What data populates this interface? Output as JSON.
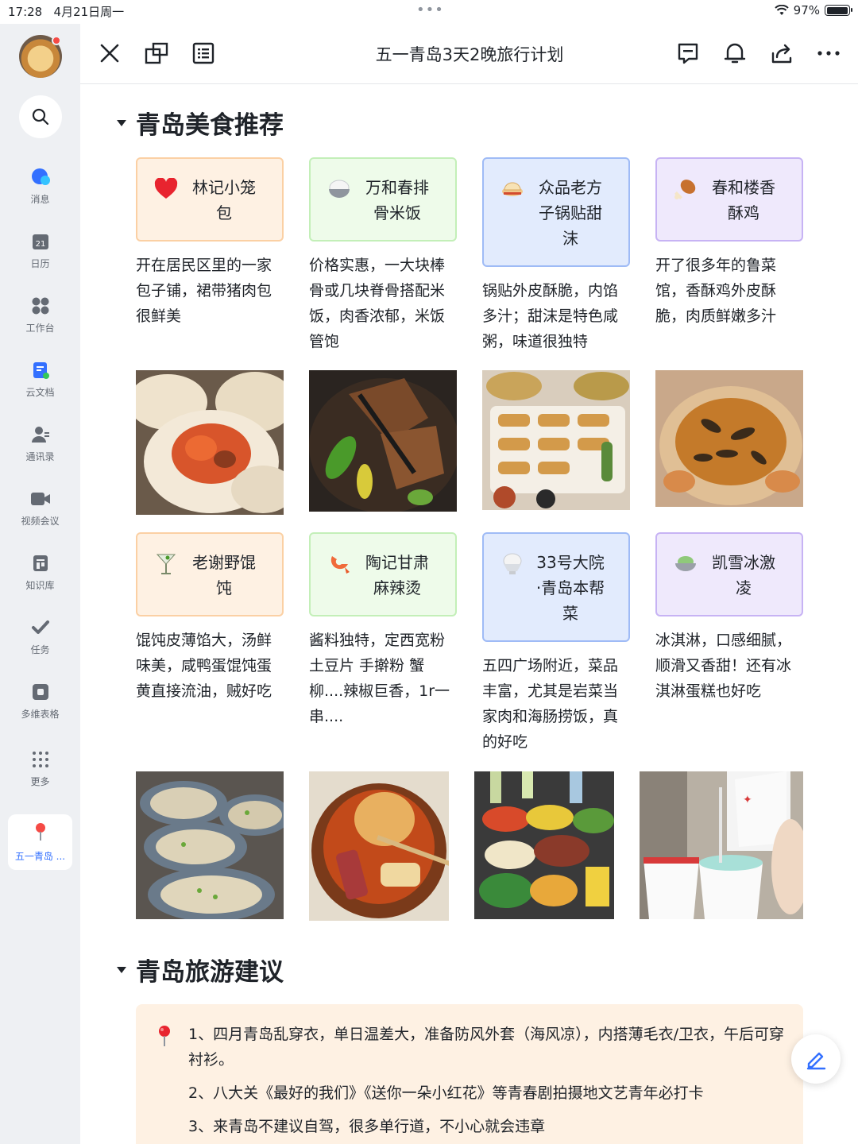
{
  "status_bar": {
    "time": "17:28",
    "date": "4月21日周一",
    "battery": "97%",
    "battery_level": 0.97
  },
  "sidebar": {
    "items": [
      {
        "label": "消息",
        "icon": "message-icon"
      },
      {
        "label": "日历",
        "icon": "calendar-icon",
        "badge": "21"
      },
      {
        "label": "工作台",
        "icon": "workbench-icon"
      },
      {
        "label": "云文档",
        "icon": "cloud-doc-icon"
      },
      {
        "label": "通讯录",
        "icon": "contacts-icon"
      },
      {
        "label": "视频会议",
        "icon": "video-meeting-icon"
      },
      {
        "label": "知识库",
        "icon": "wiki-icon"
      },
      {
        "label": "任务",
        "icon": "task-icon"
      },
      {
        "label": "多维表格",
        "icon": "base-icon"
      },
      {
        "label": "更多",
        "icon": "more-grid-icon"
      }
    ],
    "active_tab": {
      "label": "五一青岛 ...",
      "icon": "pin-icon"
    }
  },
  "toolbar": {
    "title": "五一青岛3天2晚旅行计划"
  },
  "sections": {
    "food": {
      "heading": "青岛美食推荐"
    },
    "travel": {
      "heading": "青岛旅游建议"
    }
  },
  "food": {
    "row1": [
      {
        "name": "林记小笼包",
        "name_lines": [
          "林记小笼",
          "包"
        ],
        "icon": "heart-icon",
        "desc": "开在居民区里的一家包子铺，裙带猪肉包很鲜美",
        "photo": "steamed-buns-photo"
      },
      {
        "name": "万和春排骨米饭",
        "name_lines": [
          "万和春排",
          "骨米饭"
        ],
        "icon": "rice-bowl-icon",
        "desc": "价格实惠，一大块棒骨或几块脊骨搭配米饭，肉香浓郁，米饭管饱",
        "photo": "braised-ribs-photo"
      },
      {
        "name": "众品老方子锅贴甜沫",
        "name_lines": [
          "众品老方",
          "子锅贴甜",
          "沫"
        ],
        "icon": "dumpling-icon",
        "desc": "锅贴外皮酥脆，内馅多汁；甜沫是特色咸粥，味道很独特",
        "photo": "potstickers-photo"
      },
      {
        "name": "春和楼香酥鸡",
        "name_lines": [
          "春和楼香",
          "酥鸡"
        ],
        "icon": "drumstick-icon",
        "desc": "开了很多年的鲁菜馆，香酥鸡外皮酥脆，肉质鲜嫩多汁",
        "photo": "crispy-chicken-photo"
      }
    ],
    "row2": [
      {
        "name": "老谢野馄饨",
        "name_lines": [
          "老谢野馄",
          "饨"
        ],
        "icon": "cocktail-icon",
        "desc": "馄饨皮薄馅大，汤鲜味美，咸鸭蛋馄饨蛋黄直接流油，贼好吃",
        "photo": "wonton-photo"
      },
      {
        "name": "陶记甘肃麻辣烫",
        "name_lines": [
          "陶记甘肃",
          "麻辣烫"
        ],
        "icon": "shrimp-icon",
        "desc": "酱料独特，定西宽粉 土豆片 手擀粉 蟹柳....辣椒巨香，1r一串....",
        "photo": "malatang-photo"
      },
      {
        "name": "33号大院·青岛本帮菜",
        "name_lines": [
          "33号大院",
          "·青岛本帮",
          "菜"
        ],
        "icon": "shaved-ice-icon",
        "desc": "五四广场附近，菜品丰富，尤其是岩菜当家肉和海肠捞饭，真的好吃",
        "photo": "seafood-feast-photo"
      },
      {
        "name": "凯雪冰激凌",
        "name_lines": [
          "凯雪冰激",
          "凌"
        ],
        "icon": "ice-cream-bowl-icon",
        "desc": "冰淇淋，口感细腻，顺滑又香甜！还有冰淇淋蛋糕也好吃",
        "photo": "ice-cream-cups-photo"
      }
    ]
  },
  "travel_tips": [
    "1、四月青岛乱穿衣，单日温差大，准备防风外套（海风凉），内搭薄毛衣/卫衣，午后可穿衬衫。",
    "2、八大关《最好的我们》《送你一朵小红花》等青春剧拍摄地文艺青年必打卡",
    "3、来青岛不建议自驾，很多单行道，不小心就会违章"
  ],
  "colors": {
    "accent": "#3370ff",
    "card_orange": "#fef1e3",
    "card_green": "#eefbea",
    "card_blue": "#e2ebfd",
    "card_purple": "#efe9fc"
  }
}
